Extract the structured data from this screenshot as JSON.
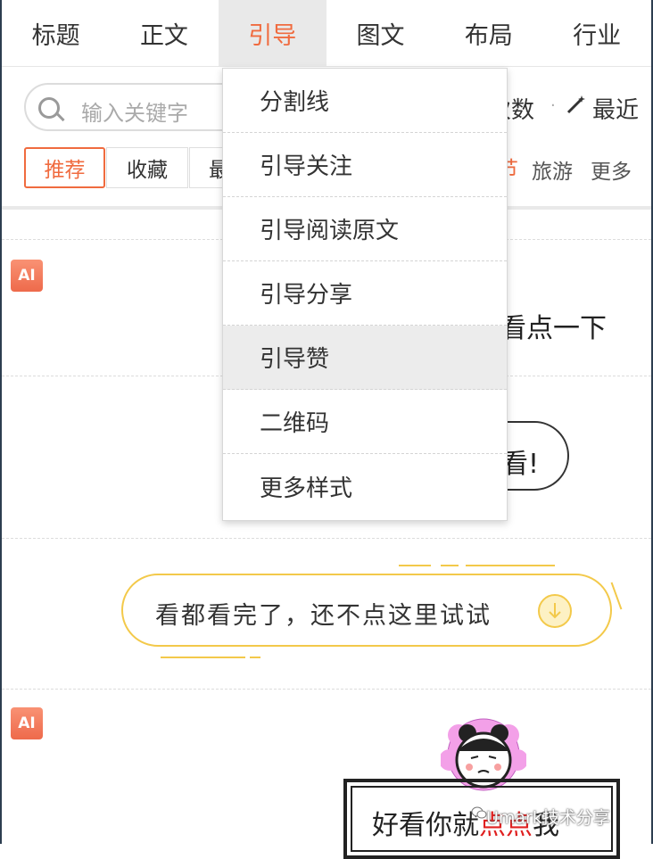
{
  "nav": {
    "tabs": [
      {
        "label": "标题"
      },
      {
        "label": "正文"
      },
      {
        "label": "引导",
        "active": true
      },
      {
        "label": "图文"
      },
      {
        "label": "布局"
      },
      {
        "label": "行业"
      }
    ]
  },
  "toolbar": {
    "search_placeholder": "输入关键字",
    "sort_count_label": "次数",
    "sort_separator": "·",
    "sort_recent_label": "最近",
    "chips": [
      {
        "label": "推荐",
        "active": true
      },
      {
        "label": "收藏"
      },
      {
        "label": "最"
      }
    ],
    "categories": [
      {
        "label": "节"
      },
      {
        "label": "旅游"
      },
      {
        "label": "更多"
      }
    ]
  },
  "dropdown": {
    "items": [
      {
        "label": "分割线"
      },
      {
        "label": "引导关注"
      },
      {
        "label": "引导阅读原文"
      },
      {
        "label": "引导分享"
      },
      {
        "label": "引导赞",
        "hovered": true
      },
      {
        "label": "二维码"
      },
      {
        "label": "更多样式"
      }
    ]
  },
  "templates": {
    "ai_badge": "AI",
    "item1_text": "看点一下",
    "item2_text": "看!",
    "item3_text": "看都看完了，还不点这里试试",
    "item4_text_a": "好看你就",
    "item4_text_b": "点点",
    "item4_text_c": "我"
  },
  "watermark": "Umark技术分享",
  "colors": {
    "accent": "#f06b3f",
    "ai_badge": "#ef6f52",
    "guide_yellow": "#f3c94a",
    "red_text": "#e02020"
  }
}
